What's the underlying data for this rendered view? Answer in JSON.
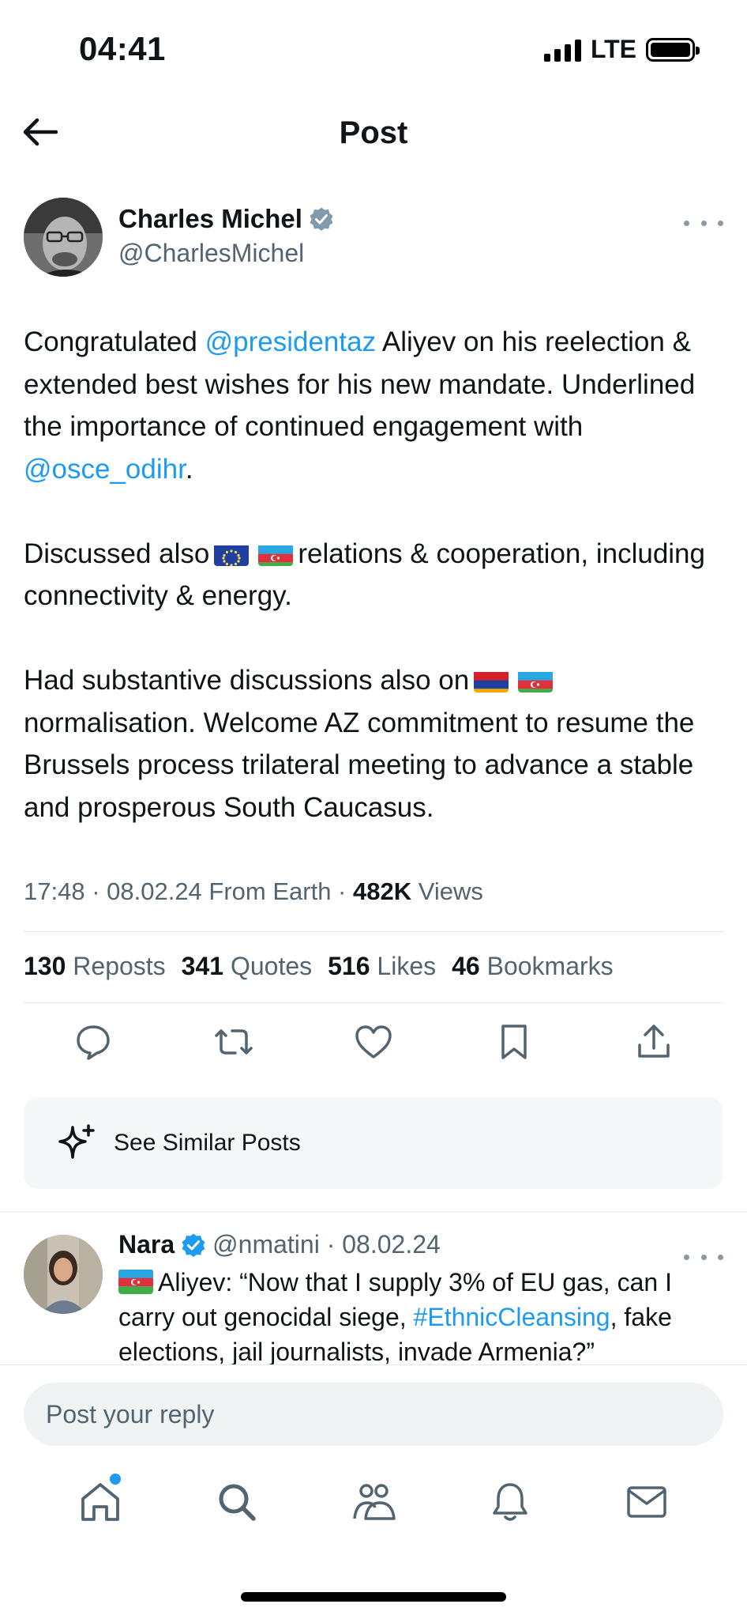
{
  "status_bar": {
    "time": "04:41",
    "network": "LTE"
  },
  "header": {
    "title": "Post"
  },
  "author": {
    "name": "Charles Michel",
    "handle": "@CharlesMichel"
  },
  "post": {
    "p1_part1": "Congratulated ",
    "p1_mention1": "@presidentaz",
    "p1_part2": " Aliyev on his reelection & extended best wishes for his new mandate. Underlined the importance of continued engagement with ",
    "p1_mention2": "@osce_odihr",
    "p1_part3": ".",
    "p2_part1": "Discussed also",
    "p2_part2": "relations & cooperation, including connectivity & energy.",
    "p3_part1": "Had substantive discussions also on",
    "p3_part2": "normalisation. Welcome AZ commitment to resume the Brussels process trilateral meeting to advance a stable and prosperous South Caucasus."
  },
  "meta": {
    "time_date_source": "17:48 · 08.02.24 From Earth · ",
    "views_count": "482K",
    "views_label": " Views"
  },
  "stats": {
    "reposts_count": "130",
    "reposts_label": "Reposts",
    "quotes_count": "341",
    "quotes_label": "Quotes",
    "likes_count": "516",
    "likes_label": "Likes",
    "bookmarks_count": "46",
    "bookmarks_label": "Bookmarks"
  },
  "similar": {
    "label": "See Similar Posts"
  },
  "reply": {
    "name": "Nara",
    "handle_date": "@nmatini · 08.02.24",
    "text_part1": "Aliyev: “Now that I supply 3% of EU gas, can I carry out genocidal siege, ",
    "hashtag": "#EthnicCleansing",
    "text_part2": ", fake elections, jail journalists, invade Armenia?”"
  },
  "reply_input": {
    "placeholder": "Post your reply"
  },
  "colors": {
    "link": "#1d9bf0",
    "verified_gray": "#829aab",
    "verified_blue": "#1d9bf0",
    "secondary_text": "#536471"
  }
}
